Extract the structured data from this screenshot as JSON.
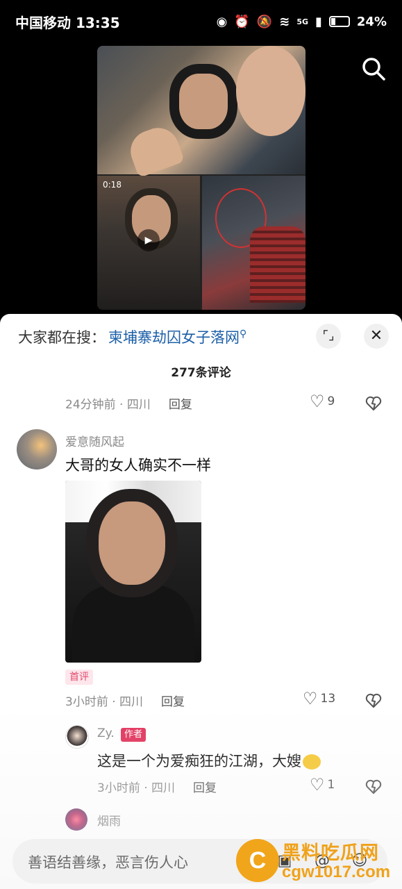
{
  "status_bar": {
    "carrier_time": "中国移动 13:35",
    "network": "5G",
    "battery": "24%"
  },
  "video": {
    "duration": "0:18"
  },
  "sheet": {
    "suggest_prefix": "大家都在搜：",
    "suggest_query": "柬埔寨劫囚女子落网",
    "comment_count": "277条评论",
    "prev_comment": {
      "time_location": "24分钟前 · 四川",
      "reply_label": "回复",
      "likes": "9"
    },
    "comments": [
      {
        "username": "爱意随风起",
        "text": "大哥的女人确实不一样",
        "badge": "首评",
        "time_location": "3小时前 · 四川",
        "reply_label": "回复",
        "likes": "13"
      }
    ],
    "reply": {
      "username": "Zy.",
      "author_badge": "作者",
      "text": "这是一个为爱痴狂的江湖，大嫂",
      "time_location": "3小时前 · 四川",
      "reply_label": "回复",
      "likes": "1"
    },
    "next_comment": {
      "username": "烟雨"
    },
    "input_placeholder": "善语结善缘，恶言伤人心"
  },
  "watermark": {
    "cn": "黑料吃瓜网",
    "url": "cgw1017.com"
  },
  "colors": {
    "link": "#1b5fa8",
    "badge": "#e2345c",
    "watermark": "#f0a21b"
  }
}
